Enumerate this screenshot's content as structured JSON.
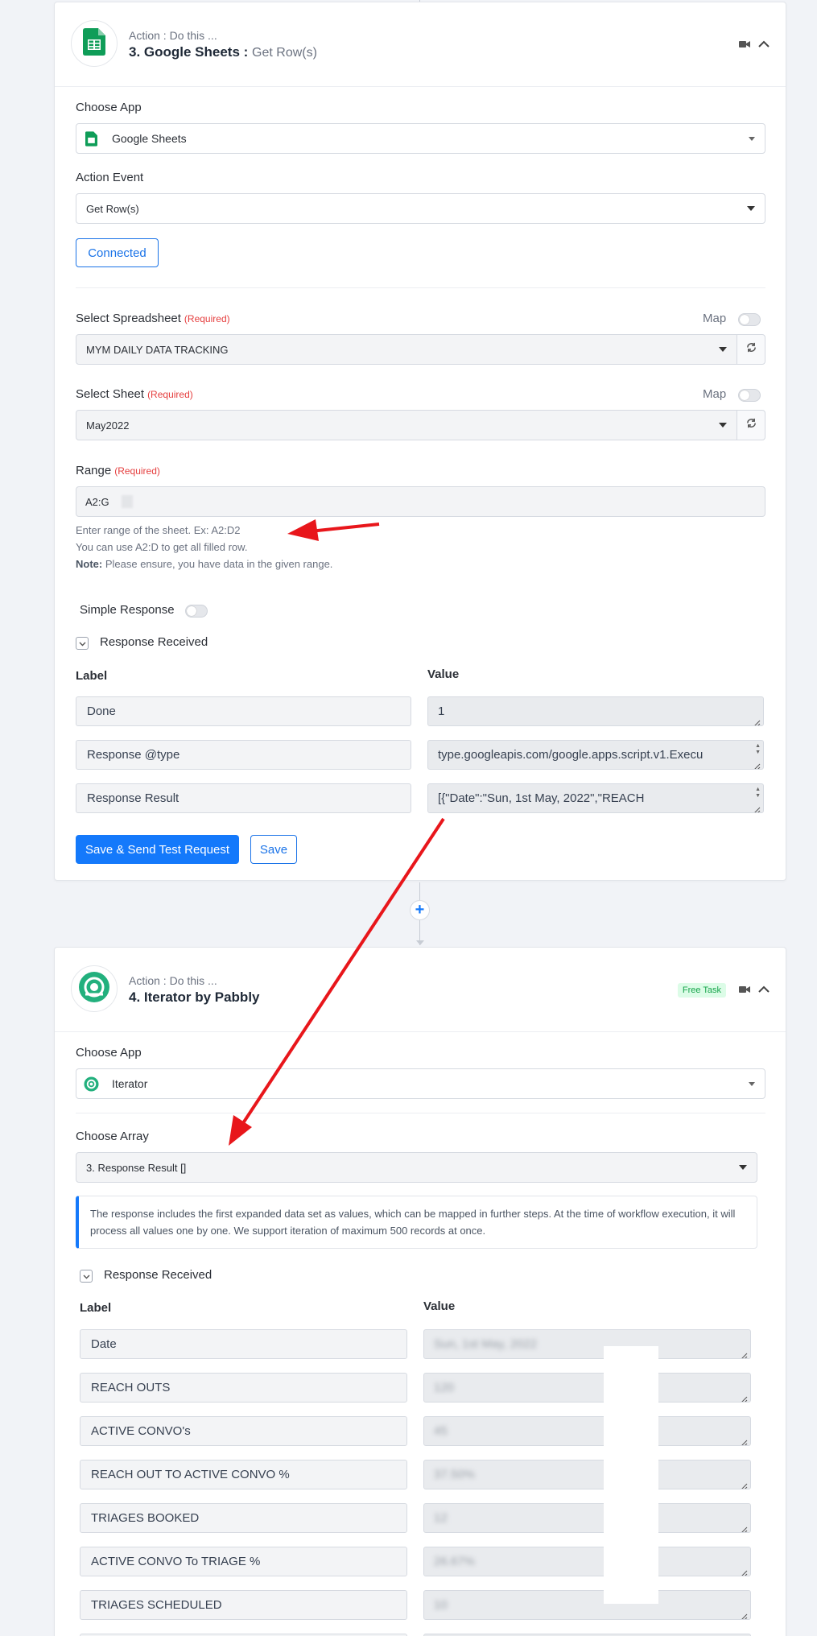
{
  "step3": {
    "subtitle": "Action : Do this ...",
    "title": "3. Google Sheets : ",
    "event": "Get Row(s)",
    "choose_app_label": "Choose App",
    "app_name": "Google Sheets",
    "action_event_label": "Action Event",
    "action_event_value": "Get Row(s)",
    "connected_label": "Connected",
    "spreadsheet_label": "Select Spreadsheet",
    "required": "(Required)",
    "map_label": "Map",
    "spreadsheet_value": "MYM DAILY DATA TRACKING",
    "sheet_label": "Select Sheet",
    "sheet_value": "May2022",
    "range_label": "Range",
    "range_value": "A2:G",
    "help_line1": "Enter range of the sheet. Ex: A2:D2",
    "help_line2": "You can use A2:D to get all filled row.",
    "help_note_bold": "Note:",
    "help_note_text": " Please ensure, you have data in the given range.",
    "simple_response_label": "Simple Response",
    "response_received_label": "Response Received",
    "col_label": "Label",
    "col_value": "Value",
    "rows": [
      {
        "label": "Done",
        "value": "1"
      },
      {
        "label": "Response @type",
        "value": "type.googleapis.com/google.apps.script.v1.Execu"
      },
      {
        "label": "Response Result",
        "value": "[{\"Date\":\"Sun, 1st May, 2022\",\"REACH"
      }
    ],
    "save_test_label": "Save & Send Test Request",
    "save_label": "Save"
  },
  "step4": {
    "subtitle": "Action : Do this ...",
    "title": "4. Iterator by Pabbly",
    "free_task": "Free Task",
    "choose_app_label": "Choose App",
    "app_name": "Iterator",
    "choose_array_label": "Choose Array",
    "array_value": "3. Response Result []",
    "info_text": "The response includes the first expanded data set as values, which can be mapped in further steps. At the time of workflow execution, it will process all values one by one. We support iteration of maximum 500 records at once.",
    "response_received_label": "Response Received",
    "col_label": "Label",
    "col_value": "Value",
    "rows": [
      {
        "label": "Date",
        "value": "Sun, 1st May, 2022"
      },
      {
        "label": "REACH OUTS",
        "value": "120"
      },
      {
        "label": "ACTIVE CONVO's",
        "value": "45"
      },
      {
        "label": "REACH OUT TO ACTIVE CONVO %",
        "value": "37.50%"
      },
      {
        "label": "TRIAGES BOOKED",
        "value": "12"
      },
      {
        "label": "ACTIVE CONVO To TRIAGE %",
        "value": "26.67%"
      },
      {
        "label": "TRIAGES SCHEDULED",
        "value": "10"
      }
    ]
  },
  "colors": {
    "primary": "#1479fb",
    "sheets_green": "#0f9d58",
    "iterator_green": "#22b07d",
    "required_red": "#e53e3e",
    "arrow_red": "#e8161b"
  },
  "icons": [
    "google-sheets-icon",
    "video-camera-icon",
    "chevron-up-icon",
    "refresh-icon",
    "chevron-down-icon",
    "iterator-icon",
    "plus-icon",
    "resize-grip-icon"
  ]
}
